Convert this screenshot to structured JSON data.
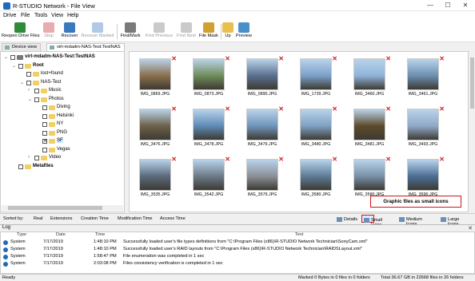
{
  "window": {
    "title": "R-STUDIO Network - File View",
    "minimize": "—",
    "maximize": "☐",
    "close": "✕"
  },
  "menu": [
    "Drive",
    "File",
    "Tools",
    "View",
    "Help"
  ],
  "toolbar": {
    "reopen": "Reopen Drive Files",
    "stop": "Stop",
    "recover": "Recover",
    "recover_marked": "Recover Marked",
    "find_mark": "Find/Mark",
    "find_previous": "Find Previous",
    "find_next": "Find Next",
    "file_mask": "File Mask",
    "up": "Up",
    "preview": "Preview"
  },
  "tabs": [
    "Device view",
    "virt-mdadm-NAS-Test:TestNAS"
  ],
  "tree": [
    {
      "label": "virt-mdadm-NAS-Test:TestNAS",
      "depth": 0,
      "expander": "⌄",
      "icon": "drive",
      "checked": false,
      "bold": true
    },
    {
      "label": "Root",
      "depth": 1,
      "expander": "⌄",
      "icon": "folder",
      "checked": false,
      "bold": true
    },
    {
      "label": "lost+found",
      "depth": 2,
      "expander": "",
      "icon": "folder",
      "checked": false
    },
    {
      "label": "NAS-Test",
      "depth": 2,
      "expander": "⌄",
      "icon": "folder",
      "checked": false
    },
    {
      "label": "Music",
      "depth": 3,
      "expander": "›",
      "icon": "folder",
      "checked": false
    },
    {
      "label": "Photos",
      "depth": 3,
      "expander": "⌄",
      "icon": "folder",
      "checked": false
    },
    {
      "label": "Diving",
      "depth": 4,
      "expander": "",
      "icon": "folder",
      "checked": false
    },
    {
      "label": "Helsinki",
      "depth": 4,
      "expander": "",
      "icon": "folder",
      "checked": false
    },
    {
      "label": "NY",
      "depth": 4,
      "expander": "",
      "icon": "folder",
      "checked": false
    },
    {
      "label": "PNG",
      "depth": 4,
      "expander": "",
      "icon": "folder",
      "checked": false
    },
    {
      "label": "SF",
      "depth": 4,
      "expander": "",
      "icon": "folder",
      "checked": true,
      "selected": true
    },
    {
      "label": "Vegas",
      "depth": 4,
      "expander": "",
      "icon": "folder",
      "checked": false
    },
    {
      "label": "Video",
      "depth": 3,
      "expander": "›",
      "icon": "folder",
      "checked": false
    },
    {
      "label": "Metafiles",
      "depth": 1,
      "expander": "",
      "icon": "folder",
      "checked": false,
      "bold": true
    }
  ],
  "files": [
    {
      "name": "IMG_0869.JPG",
      "color": "#8a6f4c"
    },
    {
      "name": "IMG_0873.JPG",
      "color": "#6f8c5a"
    },
    {
      "name": "IMG_0890.JPG",
      "color": "#5a6f8e"
    },
    {
      "name": "IMG_1739.JPG",
      "color": "#7aa0c8"
    },
    {
      "name": "IMG_3460.JPG",
      "color": "#8fb3d8"
    },
    {
      "name": "IMG_3461.JPG",
      "color": "#6b8fb0"
    },
    {
      "name": "IMG_3476.JPG",
      "color": "#6c6148"
    },
    {
      "name": "IMG_3478.JPG",
      "color": "#5e8ab5"
    },
    {
      "name": "IMG_3479.JPG",
      "color": "#6f94b9"
    },
    {
      "name": "IMG_3480.JPG",
      "color": "#7ea0c2"
    },
    {
      "name": "IMG_3481.JPG",
      "color": "#5c4a2a"
    },
    {
      "name": "IMG_3493.JPG",
      "color": "#90a8c8"
    },
    {
      "name": "IMG_3535.JPG",
      "color": "#5a6a7c"
    },
    {
      "name": "IMG_3542.JPG",
      "color": "#6b7a88"
    },
    {
      "name": "IMG_3579.JPG",
      "color": "#8a8f96"
    },
    {
      "name": "IMG_3580.JPG",
      "color": "#5d7b96"
    },
    {
      "name": "IMG_3580.JPG",
      "color": "#7790a8"
    },
    {
      "name": "IMG_3590.JPG",
      "color": "#4c6e95"
    }
  ],
  "sortbar": {
    "label": "Sorted by:",
    "options": [
      "Real",
      "Extensions",
      "Creation Time",
      "Modification Time",
      "Access Time"
    ]
  },
  "views": {
    "details": "Details",
    "small": "Small Icons",
    "medium": "Medium Icons",
    "large": "Large Icons"
  },
  "callout": "Graphic files as small icons",
  "log": {
    "title": "Log",
    "close": "✕",
    "headers": {
      "type": "Type",
      "date": "Date",
      "time": "Time",
      "text": "Text"
    },
    "rows": [
      {
        "type": "System",
        "date": "7/17/2019",
        "time": "1:48:10 PM",
        "text": "Successfully loaded user's file types definitions from \"C:\\Program Files (x86)\\R-STUDIO Network Technician\\SonyCam.xml\""
      },
      {
        "type": "System",
        "date": "7/17/2019",
        "time": "1:48:10 PM",
        "text": "Successfully loaded user's RAID layouts from \"C:\\Program Files (x86)\\R-STUDIO Network Technician\\RAIDSLayout.xml\""
      },
      {
        "type": "System",
        "date": "7/17/2019",
        "time": "1:58:47 PM",
        "text": "File enumeration was completed in 1 sec"
      },
      {
        "type": "System",
        "date": "7/17/2019",
        "time": "2:03:08 PM",
        "text": "Files consistency verification is completed in 1 sec"
      }
    ]
  },
  "status": {
    "ready": "Ready",
    "marked": "Marked 0 Bytes in 0 files in 0 folders",
    "total": "Total 36.67 GB in 22668 files in 26 folders"
  }
}
